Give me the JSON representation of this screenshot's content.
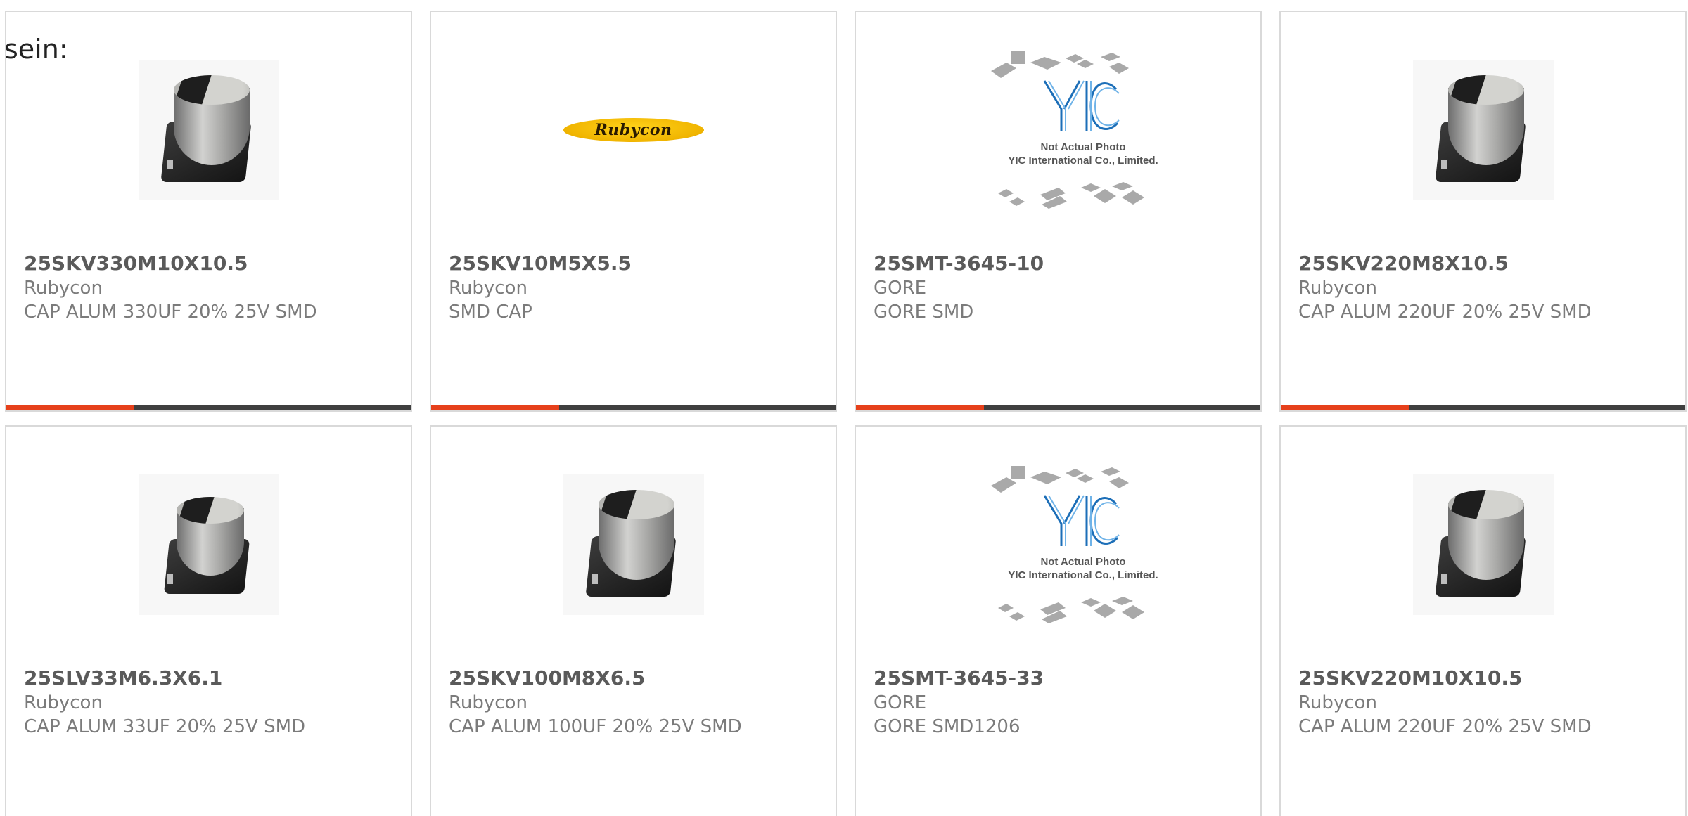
{
  "lead_text": "sein:",
  "colors": {
    "accent": "#e6401b",
    "bar": "#3f3f3f",
    "border": "#d9d9d9",
    "text_primary": "#5a5a5a",
    "text_secondary": "#7b7b7b"
  },
  "logo_text": "Rubycon",
  "placeholder": {
    "line1": "Not Actual Photo",
    "line2": "YIC International Co., Limited."
  },
  "products": [
    {
      "part": "25SKV330M10X10.5",
      "maker": "Rubycon",
      "desc": "CAP ALUM 330UF 20% 25V SMD",
      "image": "capacitor-photo"
    },
    {
      "part": "25SKV10M5X5.5",
      "maker": "Rubycon",
      "desc": "SMD CAP",
      "image": "rubycon-logo"
    },
    {
      "part": "25SMT-3645-10",
      "maker": "GORE",
      "desc": "GORE SMD",
      "image": "not-actual-photo"
    },
    {
      "part": "25SKV220M8X10.5",
      "maker": "Rubycon",
      "desc": "CAP ALUM 220UF 20% 25V SMD",
      "image": "capacitor-photo"
    },
    {
      "part": "25SLV33M6.3X6.1",
      "maker": "Rubycon",
      "desc": "CAP ALUM 33UF 20% 25V SMD",
      "image": "capacitor-photo"
    },
    {
      "part": "25SKV100M8X6.5",
      "maker": "Rubycon",
      "desc": "CAP ALUM 100UF 20% 25V SMD",
      "image": "capacitor-photo"
    },
    {
      "part": "25SMT-3645-33",
      "maker": "GORE",
      "desc": "GORE SMD1206",
      "image": "not-actual-photo"
    },
    {
      "part": "25SKV220M10X10.5",
      "maker": "Rubycon",
      "desc": "CAP ALUM 220UF 20% 25V SMD",
      "image": "capacitor-photo"
    }
  ]
}
